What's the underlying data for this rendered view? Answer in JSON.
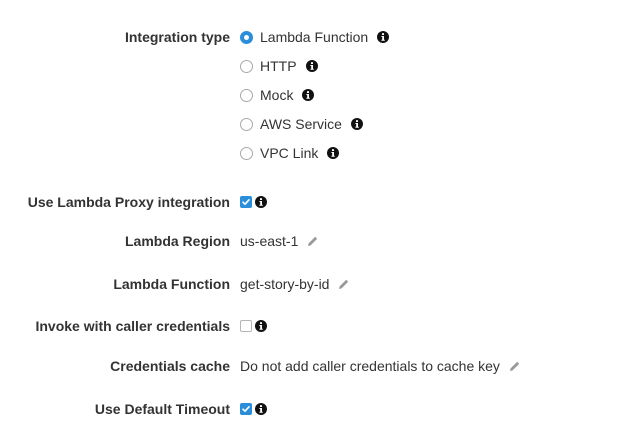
{
  "integration_type": {
    "label": "Integration type",
    "options": [
      {
        "label": "Lambda Function",
        "selected": true
      },
      {
        "label": "HTTP",
        "selected": false
      },
      {
        "label": "Mock",
        "selected": false
      },
      {
        "label": "AWS Service",
        "selected": false
      },
      {
        "label": "VPC Link",
        "selected": false
      }
    ]
  },
  "proxy_integration": {
    "label": "Use Lambda Proxy integration",
    "checked": true
  },
  "lambda_region": {
    "label": "Lambda Region",
    "value": "us-east-1"
  },
  "lambda_function": {
    "label": "Lambda Function",
    "value": "get-story-by-id"
  },
  "invoke_credentials": {
    "label": "Invoke with caller credentials",
    "checked": false
  },
  "credentials_cache": {
    "label": "Credentials cache",
    "value": "Do not add caller credentials to cache key"
  },
  "default_timeout": {
    "label": "Use Default Timeout",
    "checked": true
  },
  "colors": {
    "accent": "#2b8eda",
    "text": "#333333",
    "icon": "#111111",
    "pencil": "#999999"
  }
}
